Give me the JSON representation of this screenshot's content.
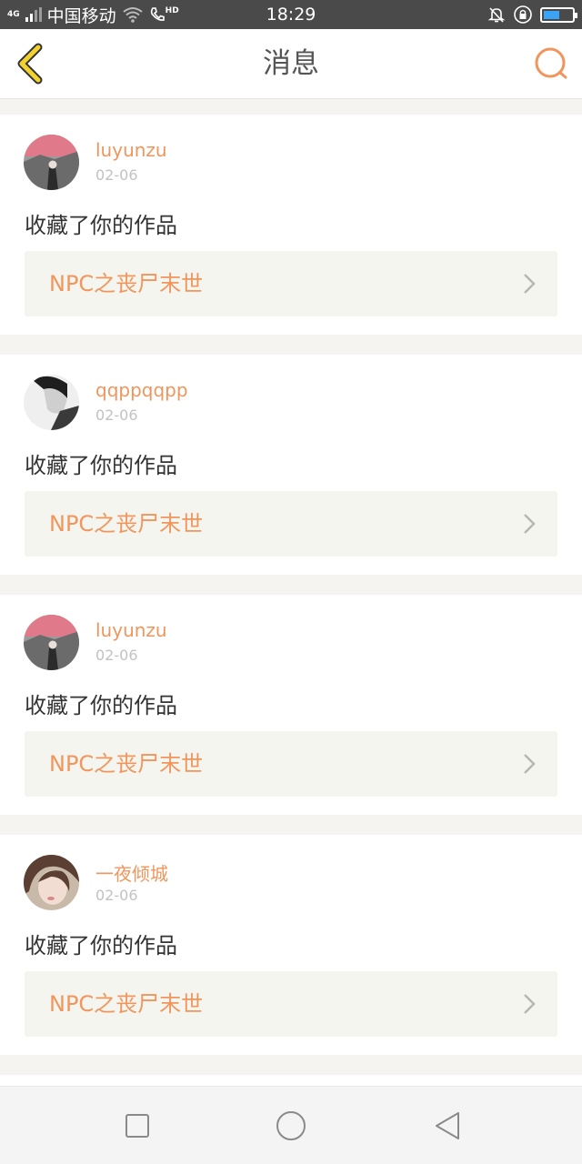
{
  "status_bar": {
    "network": "4G",
    "carrier": "中国移动",
    "call_badge": "HD",
    "time": "18:29"
  },
  "header": {
    "title": "消息",
    "back_icon": "chevron-left-icon",
    "search_icon": "search-icon"
  },
  "colors": {
    "accent": "#f0965c",
    "back_yellow": "#f2d22e"
  },
  "notifications": [
    {
      "username": "luyunzu",
      "date": "02-06",
      "action": "收藏了你的作品",
      "work_title": "NPC之丧尸末世"
    },
    {
      "username": "qqppqqpp",
      "date": "02-06",
      "action": "收藏了你的作品",
      "work_title": "NPC之丧尸末世"
    },
    {
      "username": "luyunzu",
      "date": "02-06",
      "action": "收藏了你的作品",
      "work_title": "NPC之丧尸末世"
    },
    {
      "username": "一夜倾城",
      "date": "02-06",
      "action": "收藏了你的作品",
      "work_title": "NPC之丧尸末世"
    }
  ],
  "system_nav": {
    "recent_icon": "square-icon",
    "home_icon": "circle-icon",
    "back_icon": "triangle-back-icon"
  }
}
